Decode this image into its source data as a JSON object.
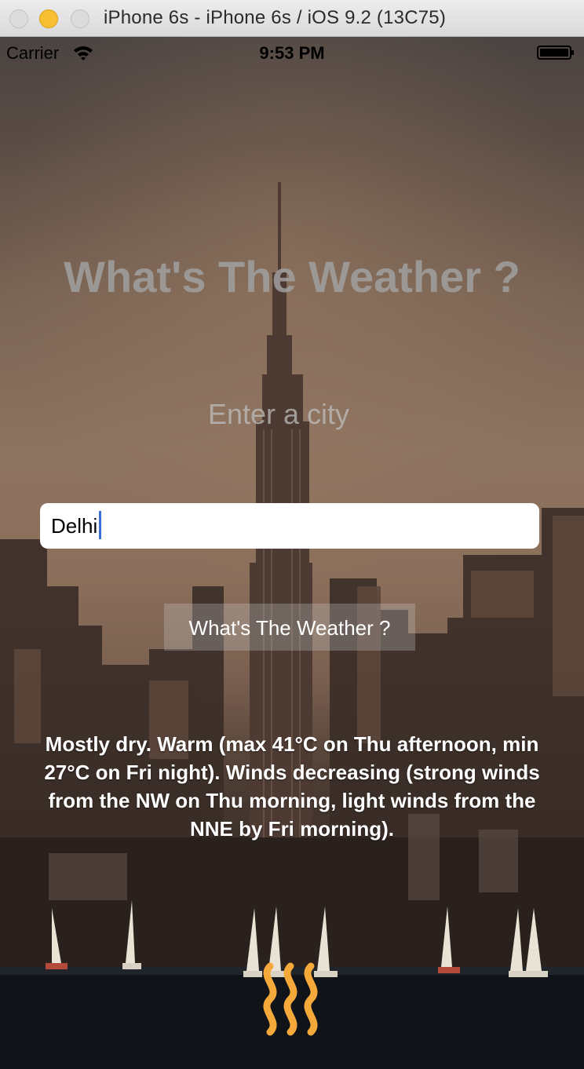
{
  "window": {
    "title": "iPhone 6s - iPhone 6s / iOS 9.2 (13C75)"
  },
  "status_bar": {
    "carrier": "Carrier",
    "time": "9:53 PM",
    "wifi_icon": "wifi-icon",
    "battery_icon": "battery-icon"
  },
  "main": {
    "headline": "What's  The Weather ?",
    "prompt": "Enter a city",
    "city_input": {
      "value": "Delhi",
      "placeholder": ""
    },
    "weather_button_label": "What's The Weather ?",
    "forecast": "Mostly dry. Warm (max 41°C on Thu afternoon, min 27°C on Fri night). Winds decreasing (strong winds from the NW on Thu morning, light winds from the NNE by Fri morning).",
    "weather_icon": "heat-wave-icon"
  },
  "colors": {
    "accent_icon": "#f4a93a",
    "caret": "#3b6fd8",
    "traffic_minimize": "#f7bf31"
  }
}
